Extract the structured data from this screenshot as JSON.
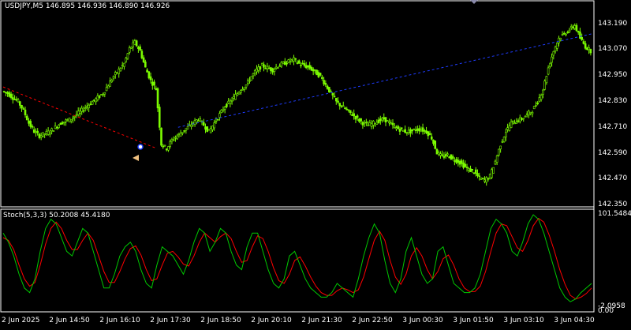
{
  "main_panel": {
    "header": "USDJPY,M5  146.895 146.936 146.890 146.926",
    "price_ticks": [
      "143.190",
      "143.070",
      "142.950",
      "142.830",
      "142.710",
      "142.590",
      "142.470",
      "142.350"
    ]
  },
  "stoch_panel": {
    "header": "Stoch(5,3,3) 50.2008 45.4180",
    "top_label": "101.5484",
    "bottom_label": "-2.0958",
    "zero_label": "0.00"
  },
  "time_axis": {
    "ticks": [
      "2 Jun 2025",
      "2 Jun 14:50",
      "2 Jun 16:10",
      "2 Jun 17:30",
      "2 Jun 18:50",
      "2 Jun 20:10",
      "2 Jun 21:30",
      "2 Jun 22:50",
      "3 Jun 00:30",
      "3 Jun 01:50",
      "3 Jun 03:10",
      "3 Jun 04:30"
    ]
  },
  "colors": {
    "background": "#000000",
    "candles": "#7CFC00",
    "main_line_red": "#FF0000",
    "signal_line_green": "#00C800",
    "trendline_red": "#FF0000",
    "trendline_blue": "#1E3CFF",
    "frame": "#FFFFFF"
  },
  "chart_data": {
    "type": "candlestick",
    "symbol": "USDJPY",
    "timeframe": "M5",
    "ylim": [
      142.32,
      143.25
    ],
    "close_path": [
      142.85,
      142.84,
      142.82,
      142.8,
      142.76,
      142.7,
      142.66,
      142.64,
      142.65,
      142.66,
      142.68,
      142.7,
      142.71,
      142.72,
      142.74,
      142.76,
      142.78,
      142.8,
      142.82,
      142.84,
      142.88,
      142.92,
      142.95,
      142.98,
      143.05,
      143.08,
      143.04,
      142.96,
      142.9,
      142.86,
      142.6,
      142.58,
      142.62,
      142.64,
      142.66,
      142.68,
      142.7,
      142.72,
      142.69,
      142.66,
      142.7,
      142.74,
      142.78,
      142.8,
      142.83,
      142.86,
      142.88,
      142.92,
      142.95,
      142.97,
      142.96,
      142.95,
      142.97,
      142.98,
      142.99,
      143.0,
      142.98,
      142.97,
      142.96,
      142.94,
      142.92,
      142.88,
      142.84,
      142.8,
      142.78,
      142.76,
      142.74,
      142.72,
      142.7,
      142.69,
      142.7,
      142.71,
      142.72,
      142.7,
      142.68,
      142.67,
      142.66,
      142.66,
      142.67,
      142.67,
      142.66,
      142.63,
      142.56,
      142.54,
      142.55,
      142.53,
      142.52,
      142.5,
      142.48,
      142.47,
      142.44,
      142.43,
      142.45,
      142.52,
      142.6,
      142.66,
      142.7,
      142.71,
      142.72,
      142.74,
      142.76,
      142.8,
      142.86,
      142.96,
      143.04,
      143.1,
      143.12,
      143.14,
      143.16,
      143.1,
      143.06,
      143.04
    ],
    "trendlines": [
      {
        "color": "red",
        "style": "dashed",
        "from": [
          0,
          142.87
        ],
        "to": [
          29,
          142.58
        ]
      },
      {
        "color": "blue",
        "style": "dashed",
        "from": [
          33,
          142.68
        ],
        "to": [
          111,
          143.12
        ]
      }
    ],
    "stoch_main": [
      80,
      70,
      55,
      35,
      20,
      15,
      30,
      60,
      85,
      95,
      90,
      75,
      60,
      55,
      70,
      85,
      80,
      60,
      40,
      20,
      20,
      35,
      55,
      65,
      70,
      60,
      40,
      25,
      20,
      45,
      65,
      60,
      55,
      45,
      35,
      50,
      70,
      85,
      80,
      60,
      70,
      85,
      80,
      60,
      45,
      40,
      65,
      80,
      80,
      60,
      40,
      25,
      20,
      30,
      55,
      60,
      45,
      30,
      20,
      15,
      10,
      10,
      15,
      25,
      20,
      15,
      10,
      30,
      55,
      75,
      90,
      80,
      50,
      25,
      15,
      30,
      60,
      75,
      55,
      35,
      25,
      30,
      60,
      65,
      45,
      25,
      20,
      15,
      15,
      20,
      35,
      60,
      85,
      95,
      90,
      80,
      60,
      55,
      70,
      90,
      100,
      95,
      80,
      60,
      40,
      20,
      10,
      5,
      8,
      15,
      20,
      25
    ],
    "stoch_signal": [
      75,
      72,
      62,
      45,
      30,
      22,
      26,
      45,
      68,
      85,
      92,
      85,
      72,
      62,
      62,
      72,
      80,
      72,
      55,
      38,
      26,
      26,
      38,
      52,
      63,
      66,
      56,
      40,
      28,
      30,
      45,
      58,
      60,
      54,
      46,
      44,
      55,
      70,
      80,
      75,
      70,
      76,
      80,
      74,
      60,
      48,
      50,
      65,
      77,
      74,
      60,
      42,
      28,
      25,
      35,
      50,
      54,
      44,
      32,
      22,
      15,
      12,
      12,
      17,
      20,
      18,
      15,
      18,
      32,
      52,
      72,
      82,
      72,
      50,
      32,
      24,
      35,
      55,
      64,
      55,
      40,
      30,
      38,
      52,
      56,
      45,
      30,
      20,
      16,
      16,
      22,
      38,
      60,
      80,
      90,
      88,
      76,
      64,
      60,
      72,
      88,
      96,
      92,
      78,
      60,
      40,
      24,
      12,
      8,
      10,
      14,
      20
    ]
  }
}
